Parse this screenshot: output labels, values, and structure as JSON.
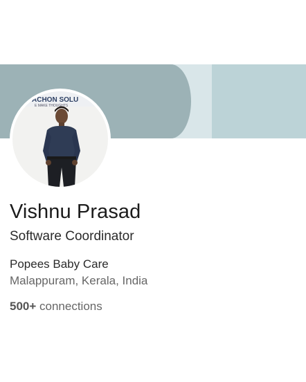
{
  "profile": {
    "name": "Vishnu Prasad",
    "headline": "Software Coordinator",
    "company": "Popees Baby Care",
    "location": "Malappuram, Kerala, India",
    "connections_count": "500+",
    "connections_label": " connections",
    "avatar_sign_text": "ACHON SOLU",
    "avatar_sign_subtext": "E MAKE THOUGHTS"
  },
  "colors": {
    "banner_dark": "#9cb2b6",
    "banner_light": "#bcd3d7",
    "banner_band": "#d9e6e9"
  },
  "icons": {
    "avatar": "profile-photo"
  }
}
